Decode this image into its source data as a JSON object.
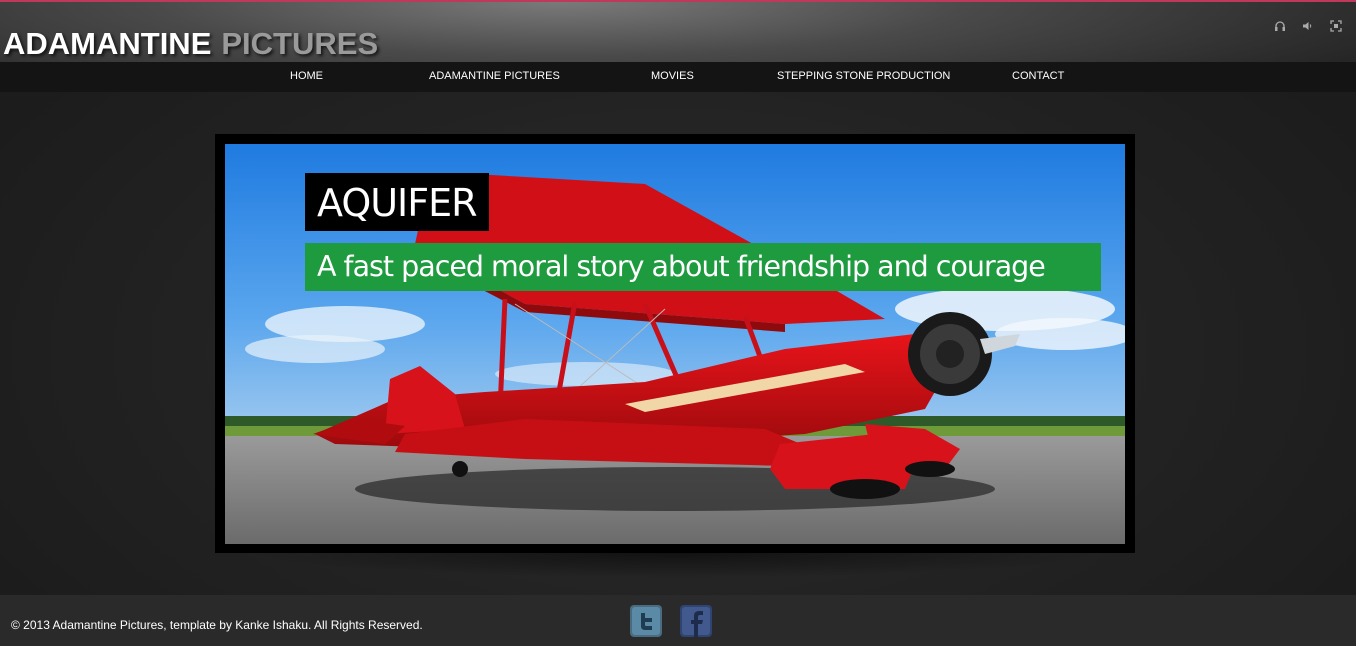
{
  "header": {
    "logo_word1": "ADAMANTINE",
    "logo_word2": "PICTURES",
    "accent_color": "#c0395a",
    "icons": [
      "headphones-icon",
      "volume-icon",
      "fullscreen-icon"
    ]
  },
  "nav": {
    "items": [
      {
        "label": "HOME"
      },
      {
        "label": "ADAMANTINE PICTURES"
      },
      {
        "label": "MOVIES"
      },
      {
        "label": "STEPPING STONE PRODUCTION"
      },
      {
        "label": "CONTACT"
      }
    ]
  },
  "slide": {
    "title": "AQUIFER",
    "caption": "A fast paced moral story about friendship and courage",
    "caption_color": "#1e9a3f",
    "image": "red-biplane-photo"
  },
  "footer": {
    "copyright": "© 2013 Adamantine Pictures, template by Kanke Ishaku. All Rights Reserved.",
    "social": [
      "twitter-icon",
      "facebook-icon"
    ]
  }
}
